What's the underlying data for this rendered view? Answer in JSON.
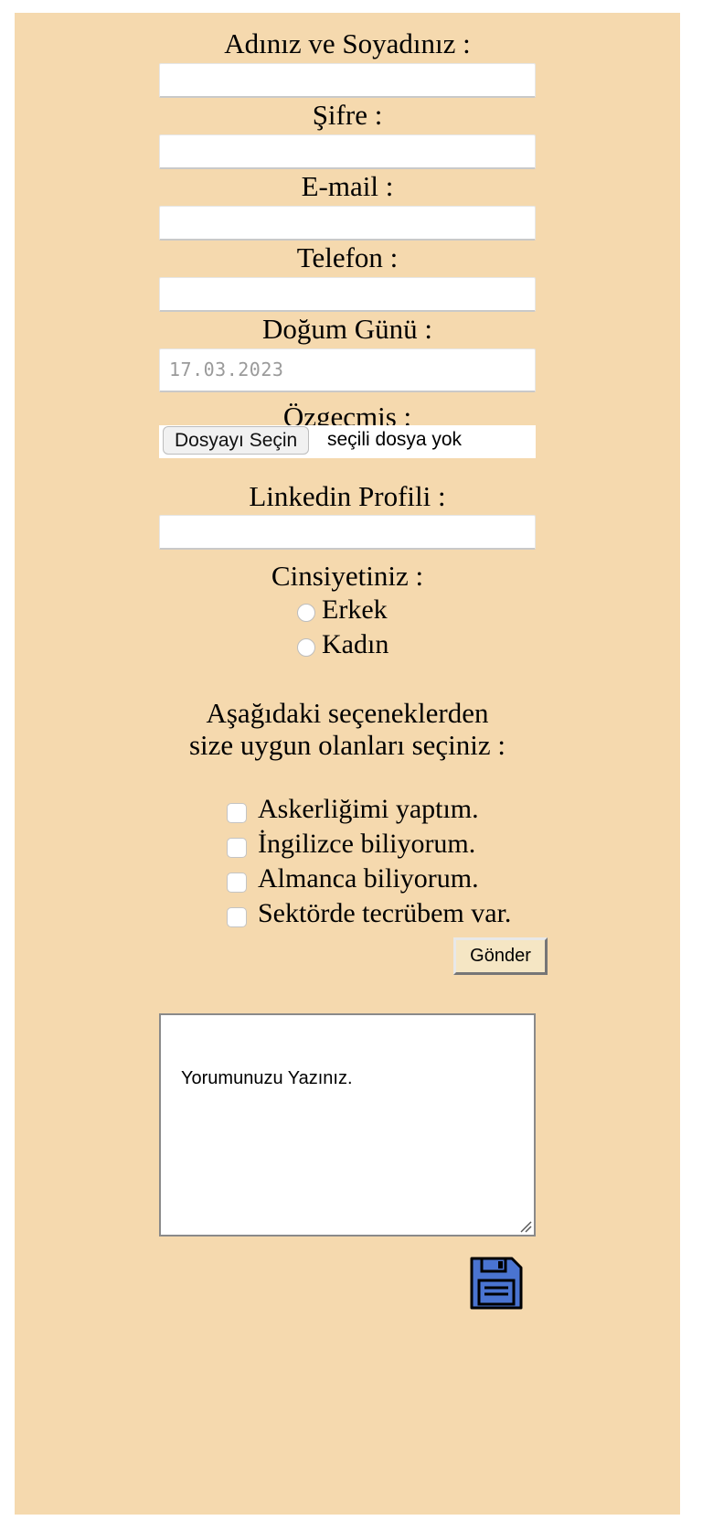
{
  "form": {
    "name_label": "Adınız ve Soyadınız :",
    "name_value": "",
    "password_label": "Şifre :",
    "password_value": "",
    "email_label": "E-mail :",
    "email_value": "",
    "phone_label": "Telefon :",
    "phone_value": "",
    "birthday_label": "Doğum Günü :",
    "birthday_value": "17.03.2023",
    "resume_label": "Özgeçmiş :",
    "file_button": "Dosyayı Seçin",
    "file_status": "seçili dosya yok",
    "linkedin_label": "Linkedin Profili :",
    "linkedin_value": "",
    "gender_label": "Cinsiyetiniz :",
    "gender_options": [
      "Erkek",
      "Kadın"
    ],
    "options_intro_line1": "Aşağıdaki seçeneklerden",
    "options_intro_line2": "size uygun olanları seçiniz :",
    "checkbox_options": [
      "Askerliğimi yaptım.",
      "İngilizce biliyorum.",
      "Almanca biliyorum.",
      "Sektörde tecrübem var."
    ],
    "submit_label": "Gönder",
    "comment_text": "Yorumunuzu Yazınız.",
    "save_icon": "floppy-disk-icon"
  },
  "colors": {
    "panel_background": "#f5d9ae",
    "save_icon_fill": "#4a74d1"
  }
}
